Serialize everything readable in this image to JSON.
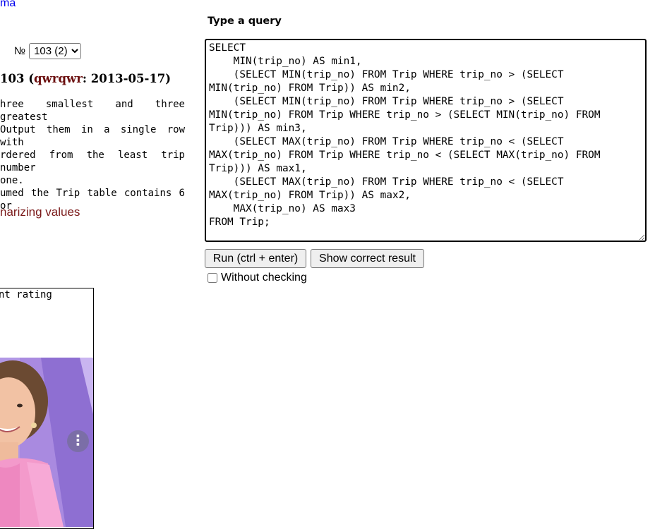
{
  "nav": {
    "schema_link": "ma"
  },
  "exercise": {
    "number_prefix": "№",
    "selected_option": "103 (2)",
    "title_number": "103",
    "title_author": "qwrqwr",
    "title_date": "2013-05-17",
    "task_lines": [
      "hree smallest and three greatest",
      "Output them in a single row with",
      "rdered from the least trip number",
      "one.",
      "umed the Trip table contains 6 or"
    ],
    "topic_link": "narizing values"
  },
  "sidebar": {
    "rating_label": "nt rating",
    "ad_menu_label": "⋮"
  },
  "query": {
    "heading": "Type a query",
    "text": "SELECT\n    MIN(trip_no) AS min1,\n    (SELECT MIN(trip_no) FROM Trip WHERE trip_no > (SELECT MIN(trip_no) FROM Trip)) AS min2,\n    (SELECT MIN(trip_no) FROM Trip WHERE trip_no > (SELECT MIN(trip_no) FROM Trip WHERE trip_no > (SELECT MIN(trip_no) FROM Trip))) AS min3,\n    (SELECT MAX(trip_no) FROM Trip WHERE trip_no < (SELECT MAX(trip_no) FROM Trip WHERE trip_no < (SELECT MAX(trip_no) FROM Trip))) AS max1,\n    (SELECT MAX(trip_no) FROM Trip WHERE trip_no < (SELECT MAX(trip_no) FROM Trip)) AS max2,\n    MAX(trip_no) AS max3\nFROM Trip;",
    "run_label": "Run (ctrl + enter)",
    "show_result_label": "Show correct result",
    "without_checking_label": "Without checking",
    "without_checking_checked": false
  },
  "colors": {
    "link": "#0000ee",
    "author": "#6b0f0f",
    "topic": "#7a1919",
    "ad_background": "#a98ae0"
  }
}
